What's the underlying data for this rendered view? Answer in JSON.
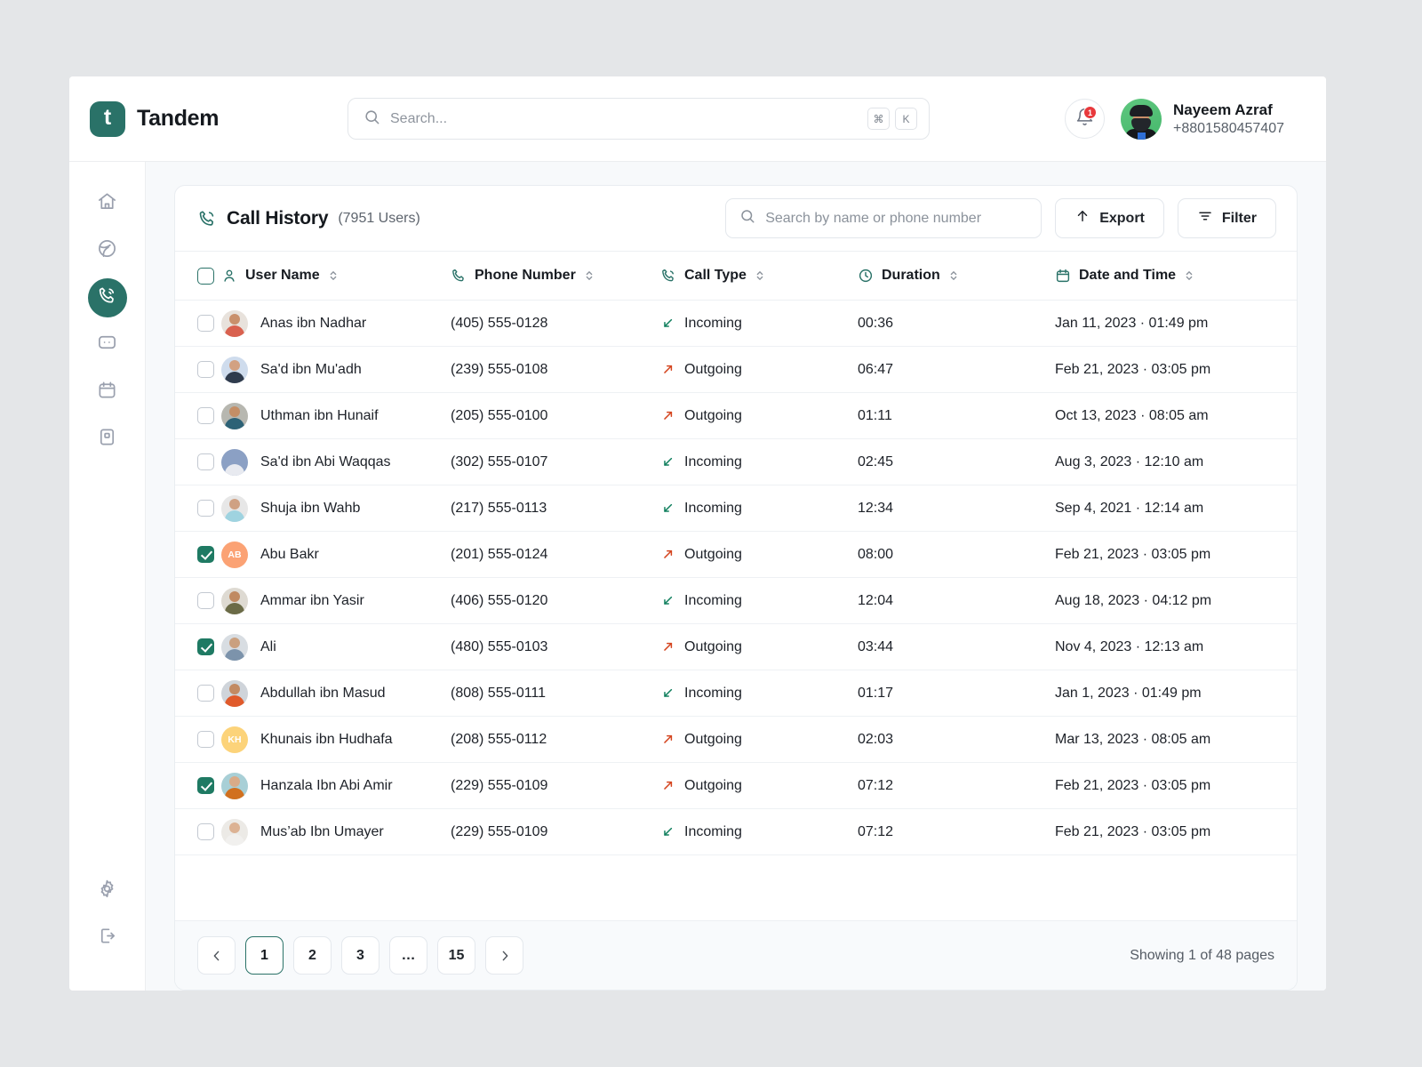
{
  "brand": {
    "logo_letter": "t",
    "name": "Tandem"
  },
  "global_search": {
    "placeholder": "Search...",
    "kbd": [
      "⌘",
      "K"
    ]
  },
  "notifications": {
    "count": "1",
    "icon": "bell-icon"
  },
  "account": {
    "name": "Nayeem Azraf",
    "phone": "+8801580457407"
  },
  "sidebar": {
    "items": [
      {
        "icon": "home-icon",
        "name": "home",
        "active": false
      },
      {
        "icon": "globe-icon",
        "name": "explore",
        "active": false
      },
      {
        "icon": "phone-call-icon",
        "name": "calls",
        "active": true
      },
      {
        "icon": "message-icon",
        "name": "messages",
        "active": false
      },
      {
        "icon": "calendar-icon",
        "name": "calendar",
        "active": false
      },
      {
        "icon": "book-icon",
        "name": "directory",
        "active": false
      }
    ],
    "bottom_items": [
      {
        "icon": "gear-icon",
        "name": "settings"
      },
      {
        "icon": "logout-icon",
        "name": "logout"
      }
    ]
  },
  "panel": {
    "title": "Call History",
    "count_label": "(7951 Users)",
    "title_icon": "phone-call-icon",
    "search_placeholder": "Search by name or phone number",
    "export_label": "Export",
    "filter_label": "Filter"
  },
  "table": {
    "columns": [
      {
        "label": "User Name",
        "icon": "user-icon",
        "sortable": true
      },
      {
        "label": "Phone Number",
        "icon": "phone-icon",
        "sortable": true
      },
      {
        "label": "Call Type",
        "icon": "phone-call-icon",
        "sortable": true
      },
      {
        "label": "Duration",
        "icon": "clock-icon",
        "sortable": true
      },
      {
        "label": "Date and Time",
        "icon": "calendar-icon",
        "sortable": true
      }
    ],
    "rows": [
      {
        "checked": false,
        "name": "Anas ibn Nadhar",
        "phone": "(405) 555-0128",
        "type": "Incoming",
        "duration": "00:36",
        "datetime": "Jan 11, 2023 · 01:49 pm",
        "avatar": {
          "kind": "photo",
          "skin": "#c9906c",
          "shirt": "#d9614f",
          "bg": "#e8e2dc"
        }
      },
      {
        "checked": false,
        "name": "Sa'd ibn Mu'adh",
        "phone": "(239) 555-0108",
        "type": "Outgoing",
        "duration": "06:47",
        "datetime": "Feb 21, 2023 · 03:05 pm",
        "avatar": {
          "kind": "photo",
          "skin": "#d2a182",
          "shirt": "#2f3b4d",
          "bg": "#cfdced"
        }
      },
      {
        "checked": false,
        "name": "Uthman ibn Hunaif",
        "phone": "(205) 555-0100",
        "type": "Outgoing",
        "duration": "01:11",
        "datetime": "Oct 13, 2023 · 08:05 am",
        "avatar": {
          "kind": "photo",
          "skin": "#c48e66",
          "shirt": "#2d6276",
          "bg": "#b7b7b0"
        }
      },
      {
        "checked": false,
        "name": "Sa'd ibn Abi Waqqas",
        "phone": "(302) 555-0107",
        "type": "Incoming",
        "duration": "02:45",
        "datetime": "Aug 3, 2023 · 12:10 am",
        "avatar": {
          "kind": "photo",
          "skin": "#b3apt",
          "shirt": "#e8eaf0",
          "bg": "#8ba0c4"
        }
      },
      {
        "checked": false,
        "name": "Shuja ibn Wahb",
        "phone": "(217) 555-0113",
        "type": "Incoming",
        "duration": "12:34",
        "datetime": "Sep 4, 2021 · 12:14 am",
        "avatar": {
          "kind": "photo",
          "skin": "#cfa183",
          "shirt": "#9fd3e0",
          "bg": "#e7e7e7"
        }
      },
      {
        "checked": true,
        "name": "Abu Bakr",
        "phone": "(201) 555-0124",
        "type": "Outgoing",
        "duration": "08:00",
        "datetime": "Feb 21, 2023 · 03:05 pm",
        "avatar": {
          "kind": "initials",
          "initials": "AB",
          "bg": "#fba274"
        }
      },
      {
        "checked": false,
        "name": "Ammar ibn Yasir",
        "phone": "(406) 555-0120",
        "type": "Incoming",
        "duration": "12:04",
        "datetime": "Aug 18, 2023 · 04:12 pm",
        "avatar": {
          "kind": "photo",
          "skin": "#c08a62",
          "shirt": "#6b6b47",
          "bg": "#dedad2"
        }
      },
      {
        "checked": true,
        "name": "Ali",
        "phone": "(480) 555-0103",
        "type": "Outgoing",
        "duration": "03:44",
        "datetime": "Nov 4, 2023 · 12:13 am",
        "avatar": {
          "kind": "photo",
          "skin": "#caa07f",
          "shirt": "#7c93ab",
          "bg": "#d8dde2"
        }
      },
      {
        "checked": false,
        "name": "Abdullah ibn Masud",
        "phone": "(808) 555-0111",
        "type": "Incoming",
        "duration": "01:17",
        "datetime": "Jan 1, 2023 · 01:49 pm",
        "avatar": {
          "kind": "photo",
          "skin": "#c28a63",
          "shirt": "#e05a2b",
          "bg": "#cfd4da"
        }
      },
      {
        "checked": false,
        "name": "Khunais ibn Hudhafa",
        "phone": "(208) 555-0112",
        "type": "Outgoing",
        "duration": "02:03",
        "datetime": "Mar 13, 2023 · 08:05 am",
        "avatar": {
          "kind": "initials",
          "initials": "KH",
          "bg": "#fcd37a"
        }
      },
      {
        "checked": true,
        "name": "Hanzala Ibn Abi Amir",
        "phone": "(229) 555-0109",
        "type": "Outgoing",
        "duration": "07:12",
        "datetime": "Feb 21, 2023 · 03:05 pm",
        "avatar": {
          "kind": "photo",
          "skin": "#d9ab88",
          "shirt": "#d1701f",
          "bg": "#a8cfd6"
        }
      },
      {
        "checked": false,
        "name": "Mus’ab Ibn Umayer",
        "phone": "(229) 555-0109",
        "type": "Incoming",
        "duration": "07:12",
        "datetime": "Feb 21, 2023 · 03:05 pm",
        "avatar": {
          "kind": "photo",
          "skin": "#dcb293",
          "shirt": "#f1f0ee",
          "bg": "#eceae6"
        }
      }
    ]
  },
  "pagination": {
    "prev_icon": "chevron-left-icon",
    "next_icon": "chevron-right-icon",
    "pages": [
      "1",
      "2",
      "3",
      "…",
      "15"
    ],
    "active_page": "1",
    "info": "Showing 1 of 48 pages"
  },
  "colors": {
    "accent": "#2a7268",
    "checkbox_checked": "#1f7a63",
    "incoming": "#12805f",
    "outgoing": "#d4441e",
    "badge_red": "#e8393c"
  }
}
